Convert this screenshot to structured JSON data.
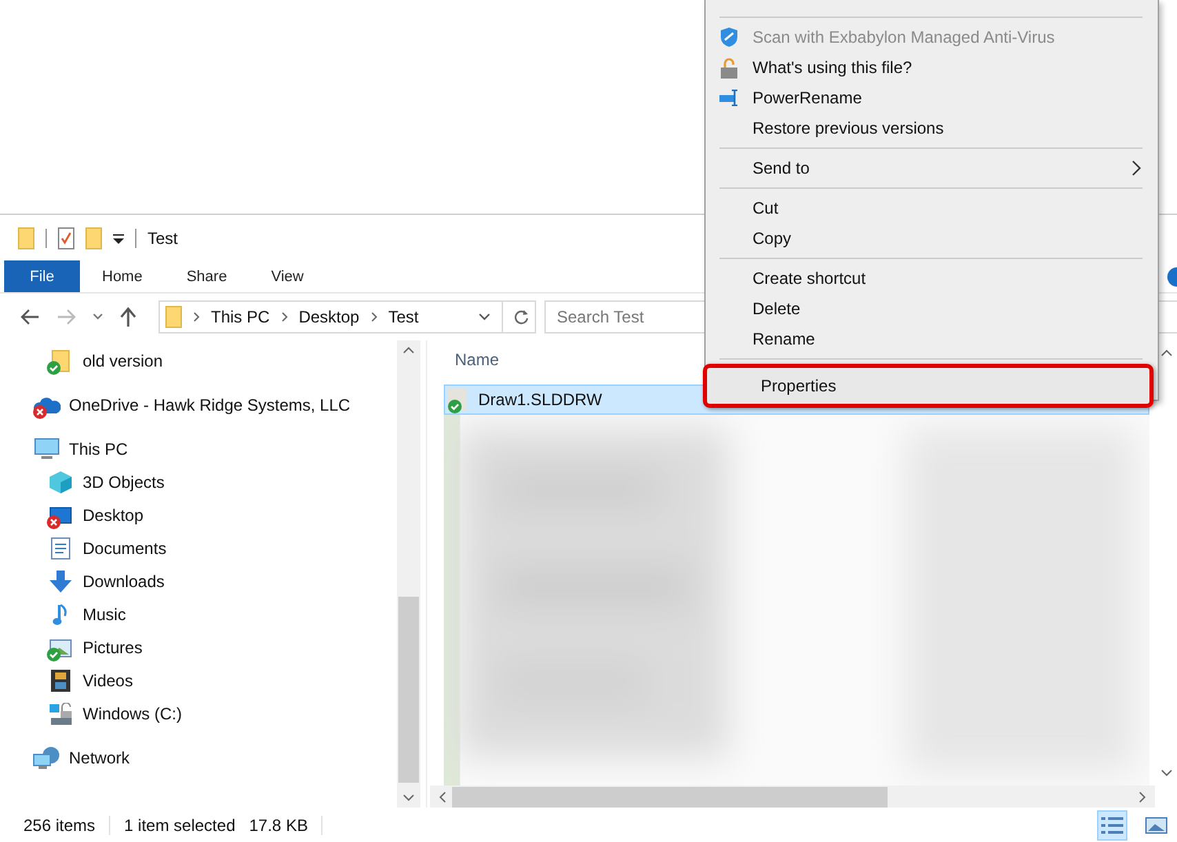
{
  "window": {
    "title": "Test",
    "ribbon_tabs": [
      {
        "label": "File",
        "selected": true
      },
      {
        "label": "Home",
        "selected": false
      },
      {
        "label": "Share",
        "selected": false
      },
      {
        "label": "View",
        "selected": false
      }
    ]
  },
  "address_bar": {
    "path": [
      "This PC",
      "Desktop",
      "Test"
    ]
  },
  "search": {
    "placeholder": "Search Test"
  },
  "navigation": {
    "tree": [
      {
        "children": [
          {
            "label": "old version",
            "synced": true
          }
        ]
      },
      {
        "label": "OneDrive - Hawk Ridge Systems, LLC",
        "sync_error": true
      },
      {
        "label": "This PC",
        "children": [
          {
            "label": "3D Objects"
          },
          {
            "label": "Desktop",
            "sync_error": true
          },
          {
            "label": "Documents"
          },
          {
            "label": "Downloads"
          },
          {
            "label": "Music"
          },
          {
            "label": "Pictures",
            "synced": true
          },
          {
            "label": "Videos"
          },
          {
            "label": "Windows (C:)"
          }
        ]
      },
      {
        "label": "Network"
      }
    ]
  },
  "file_list": {
    "columns": [
      "Name"
    ],
    "rows": [
      {
        "name": "Draw1.SLDDRW",
        "synced": true,
        "selected": true
      }
    ],
    "blurred": {
      "kind": "picture"
    }
  },
  "status_bar": {
    "item_count": "256 items",
    "selection": "1 item selected",
    "size": "17.8 KB",
    "views": [
      {
        "selected": true
      },
      {
        "selected": false
      }
    ]
  },
  "context_menu": {
    "items": [
      {
        "kind": "separator"
      },
      {
        "kind": "item",
        "label": "Scan with Exbabylon Managed Anti-Virus",
        "disabled": true,
        "highlighted": false
      },
      {
        "kind": "item",
        "label": "What's using this file?",
        "disabled": false,
        "highlighted": false
      },
      {
        "kind": "item",
        "label": "PowerRename",
        "disabled": false,
        "highlighted": false
      },
      {
        "kind": "item",
        "label": "Restore previous versions",
        "disabled": false,
        "highlighted": false
      },
      {
        "kind": "separator"
      },
      {
        "kind": "item",
        "label": "Send to",
        "disabled": false,
        "submenu": true,
        "highlighted": false
      },
      {
        "kind": "separator"
      },
      {
        "kind": "item",
        "label": "Cut",
        "disabled": false,
        "highlighted": false
      },
      {
        "kind": "item",
        "label": "Copy",
        "disabled": false,
        "highlighted": false
      },
      {
        "kind": "separator"
      },
      {
        "kind": "item",
        "label": "Create shortcut",
        "disabled": false,
        "highlighted": false
      },
      {
        "kind": "item",
        "label": "Delete",
        "disabled": false,
        "highlighted": false
      },
      {
        "kind": "item",
        "label": "Rename",
        "disabled": false,
        "highlighted": false
      },
      {
        "kind": "separator"
      },
      {
        "kind": "item",
        "label": "Properties",
        "disabled": false,
        "highlighted": true
      }
    ]
  }
}
